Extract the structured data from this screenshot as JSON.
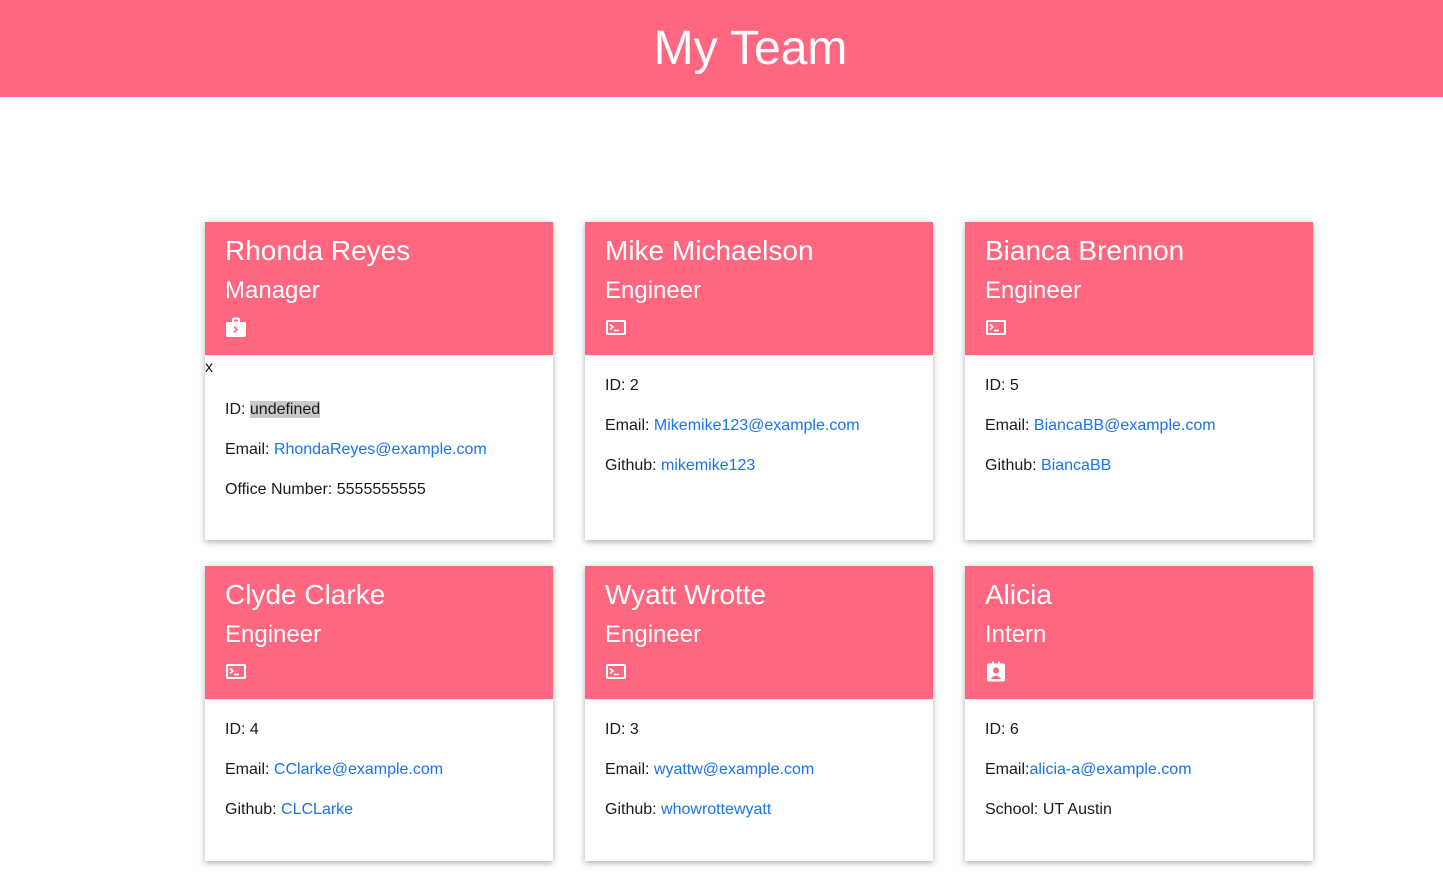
{
  "header": {
    "title": "My Team"
  },
  "cards": [
    {
      "name": "Rhonda Reyes",
      "role": "Manager",
      "icon": "briefcase-icon",
      "stray": "x",
      "id_label": "ID: ",
      "id_value": "undefined",
      "email_label": "Email: ",
      "email": "RhondaReyes@example.com",
      "extra_label": "Office Number: ",
      "extra_value": "5555555555"
    },
    {
      "name": "Mike Michaelson",
      "role": "Engineer",
      "icon": "terminal-icon",
      "id_text": "ID: 2",
      "email_label": "Email: ",
      "email": "Mikemike123@example.com",
      "extra_label": "Github: ",
      "extra_value": "mikemike123"
    },
    {
      "name": "Bianca Brennon",
      "role": "Engineer",
      "icon": "terminal-icon",
      "id_text": "ID: 5",
      "email_label": "Email: ",
      "email": "BiancaBB@example.com",
      "extra_label": "Github: ",
      "extra_value": "BiancaBB"
    },
    {
      "name": "Clyde Clarke",
      "role": "Engineer",
      "icon": "terminal-icon",
      "id_text": "ID: 4",
      "email_label": "Email: ",
      "email": "CClarke@example.com",
      "extra_label": "Github: ",
      "extra_value": "CLCLarke"
    },
    {
      "name": "Wyatt Wrotte",
      "role": "Engineer",
      "icon": "terminal-icon",
      "id_text": "ID: 3",
      "email_label": "Email: ",
      "email": "wyattw@example.com",
      "extra_label": "Github: ",
      "extra_value": "whowrottewyatt"
    },
    {
      "name": "Alicia",
      "role": "Intern",
      "icon": "id-badge-icon",
      "id_text": "ID: 6",
      "email_label": "Email:",
      "email": "alicia-a@example.com",
      "extra_text": "School: UT Austin"
    }
  ],
  "colors": {
    "accent": "#ff6780",
    "link": "#1a73e8",
    "highlight": "#c8c8c8"
  }
}
